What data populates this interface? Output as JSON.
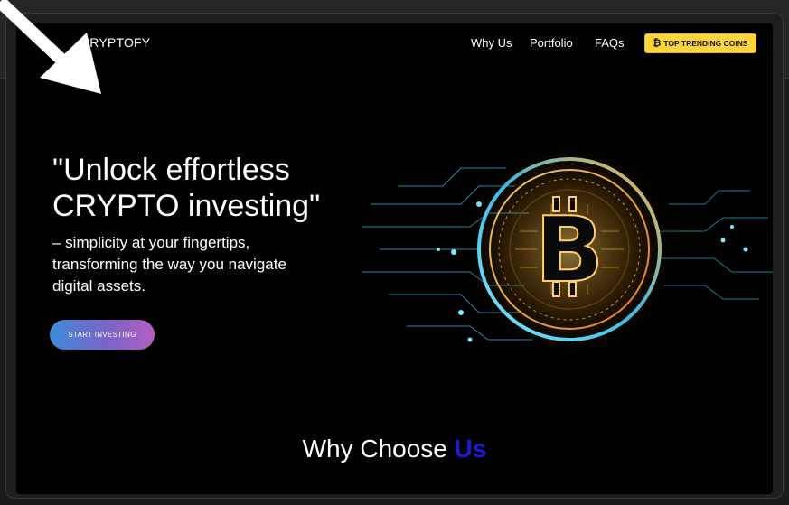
{
  "nav": {
    "brand": "CRYPTOFY",
    "links": [
      "Why Us",
      "Portfolio",
      "FAQs"
    ],
    "cta_label": "TOP TRENDING COINS",
    "cta_icon": "bitcoin-icon"
  },
  "hero": {
    "title_line1": "\"Unlock effortless",
    "title_line2": "CRYPTO investing\"",
    "sub_line1": "– simplicity at your fingertips,",
    "sub_line2": "transforming the way you navigate",
    "sub_line3": "digital assets.",
    "button_label": "START INVESTING"
  },
  "section": {
    "title_main": "Why Choose ",
    "title_accent": "Us"
  },
  "colors": {
    "accent_yellow": "#ffd53d",
    "accent_blue": "#1d1bd9",
    "button_gradient_start": "#3e8bd8",
    "button_gradient_end": "#b25fc0"
  }
}
